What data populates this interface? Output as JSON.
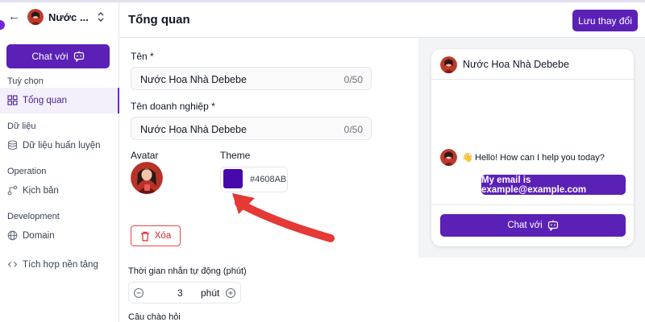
{
  "sidebar": {
    "bot_name": "Nước",
    "chat_button": "Chat với",
    "sections": [
      {
        "title": "Tuỳ chọn",
        "items": [
          {
            "label": "Tổng quan",
            "icon": "dashboard-icon",
            "active": true
          }
        ]
      },
      {
        "title": "Dữ liệu",
        "items": [
          {
            "label": "Dữ liệu huấn luyện",
            "icon": "database-icon"
          }
        ]
      },
      {
        "title": "Operation",
        "items": [
          {
            "label": "Kịch bản",
            "icon": "flow-icon"
          }
        ]
      },
      {
        "title": "Development",
        "items": [
          {
            "label": "Domain",
            "icon": "globe-icon"
          },
          {
            "label": "Tích hợp nền tảng",
            "icon": "code-icon"
          }
        ]
      }
    ]
  },
  "header": {
    "title": "Tổng quan",
    "save_button": "Lưu thay đổi"
  },
  "form": {
    "name": {
      "label": "Tên *",
      "value": "Nước Hoa Nhà Debebe",
      "counter": "0/50"
    },
    "business_name": {
      "label": "Tên doanh nghiệp *",
      "value": "Nước Hoa Nhà Debebe",
      "counter": "0/50"
    },
    "avatar_label": "Avatar",
    "theme": {
      "label": "Theme",
      "hex": "#4608AB",
      "color": "#4608AB"
    },
    "delete_button": "Xóa",
    "auto_reply": {
      "label": "Thời gian nhắn tự động (phút)",
      "value": "3",
      "unit": "phút"
    },
    "greeting_label": "Câu chào hỏi"
  },
  "preview": {
    "bot_name": "Nước Hoa Nhà Debebe",
    "bot_message": "Hello! How can I help you today?",
    "user_message": "My email is example@example.com",
    "chat_button": "Chat với"
  },
  "colors": {
    "accent": "#5b21b6",
    "danger": "#dc2626",
    "annotation_arrow": "#e53935"
  }
}
